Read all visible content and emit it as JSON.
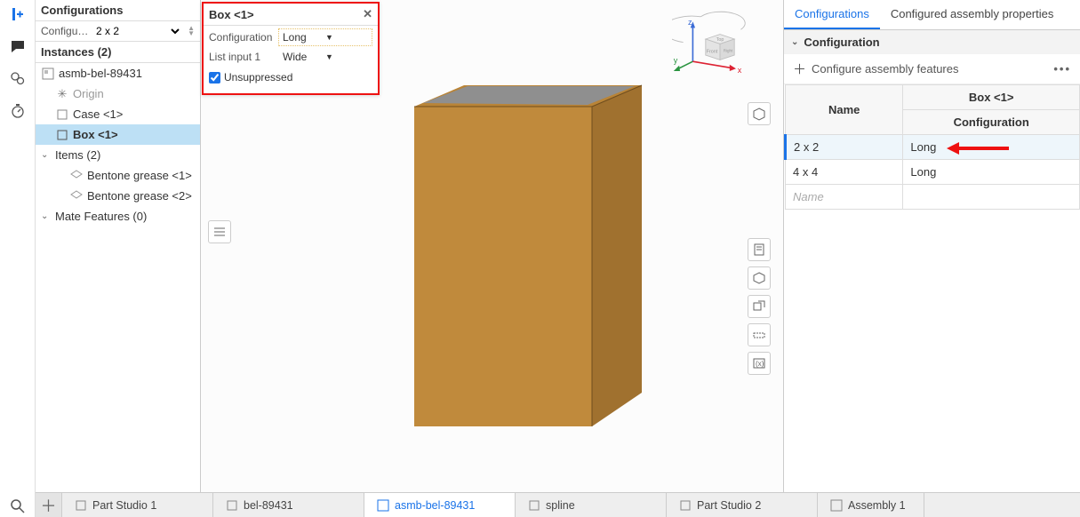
{
  "leftPanel": {
    "configHeader": "Configurations",
    "configLabel": "Configurati...",
    "configValue": "2 x 2",
    "instancesHeader": "Instances (2)",
    "tree": {
      "asm": "asmb-bel-89431",
      "origin": "Origin",
      "case": "Case <1>",
      "box": "Box <1>",
      "items": "Items (2)",
      "grease1": "Bentone grease <1>",
      "grease2": "Bentone grease <2>",
      "mate": "Mate Features (0)"
    }
  },
  "popover": {
    "title": "Box <1>",
    "configLabel": "Configuration",
    "configValue": "Long",
    "listLabel": "List input 1",
    "listValue": "Wide",
    "unsuppressed": "Unsuppressed"
  },
  "viewport": {
    "axes": {
      "x": "x",
      "y": "y",
      "z": "z"
    },
    "cube": {
      "top": "Top",
      "front": "Front",
      "right": "Right"
    }
  },
  "rightPanel": {
    "tab1": "Configurations",
    "tab2": "Configured assembly properties",
    "sectionTitle": "Configuration",
    "configureBtn": "Configure assembly features",
    "headerPart": "Box <1>",
    "colName": "Name",
    "colConfig": "Configuration",
    "rows": [
      {
        "name": "2 x 2",
        "config": "Long"
      },
      {
        "name": "4 x 4",
        "config": "Long"
      }
    ],
    "placeholder": "Name"
  },
  "bottomTabs": {
    "t1": "Part Studio 1",
    "t2": "bel-89431",
    "t3": "asmb-bel-89431",
    "t4": "spline",
    "t5": "Part Studio 2",
    "t6": "Assembly 1"
  }
}
